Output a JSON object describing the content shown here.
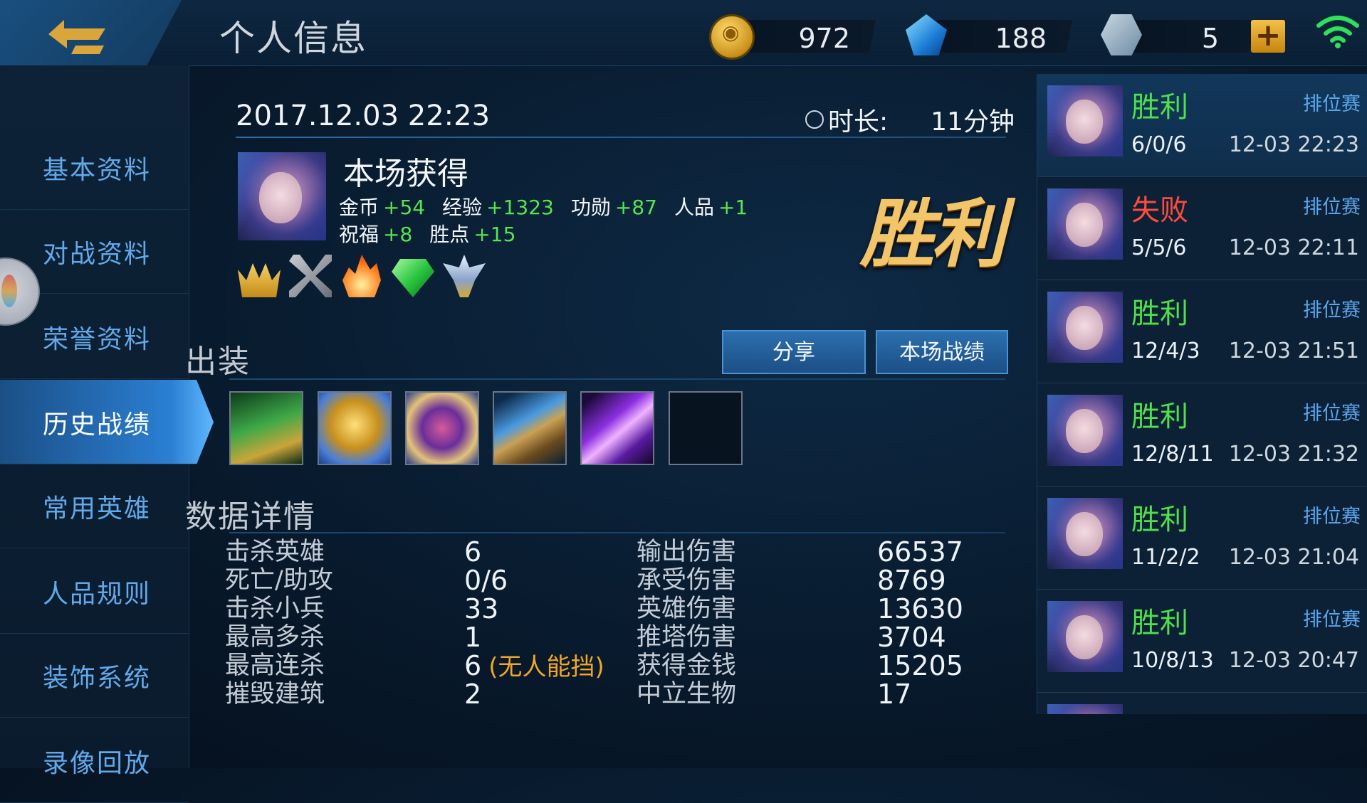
{
  "header": {
    "title": "个人信息",
    "gold": "972",
    "diamonds": "188",
    "vouchers": "5"
  },
  "sidebar": {
    "items": [
      {
        "label": "基本资料",
        "name": "sidebar-item-basic-info"
      },
      {
        "label": "对战资料",
        "name": "sidebar-item-battle-info"
      },
      {
        "label": "荣誉资料",
        "name": "sidebar-item-honor-info"
      },
      {
        "label": "历史战绩",
        "name": "sidebar-item-match-history"
      },
      {
        "label": "常用英雄",
        "name": "sidebar-item-common-heroes"
      },
      {
        "label": "人品规则",
        "name": "sidebar-item-credit-rules"
      },
      {
        "label": "装饰系统",
        "name": "sidebar-item-decoration"
      },
      {
        "label": "录像回放",
        "name": "sidebar-item-replay"
      }
    ],
    "active_index": 3
  },
  "match": {
    "datetime": "2017.12.03 22:23",
    "duration_label": "时长:",
    "duration_value": "11分钟",
    "earn_title": "本场获得",
    "rewards_row1": [
      {
        "label": "金币",
        "value": "+54"
      },
      {
        "label": "经验",
        "value": "+1323"
      },
      {
        "label": "功勋",
        "value": "+87"
      },
      {
        "label": "人品",
        "value": "+1"
      }
    ],
    "rewards_row2": [
      {
        "label": "祝福",
        "value": "+8"
      },
      {
        "label": "胜点",
        "value": "+15"
      }
    ],
    "result": "胜利",
    "badges": [
      "crown-icon",
      "crossed-swords-icon",
      "fire-icon",
      "emerald-icon",
      "winged-emblem-icon"
    ]
  },
  "equipment": {
    "title": "出装",
    "share_label": "分享",
    "scoreboard_label": "本场战绩",
    "items": [
      "boots-item-icon",
      "golden-mask-item-icon",
      "rune-axe-item-icon",
      "staff-item-icon",
      "purple-blade-item-icon",
      "empty-slot"
    ]
  },
  "stats": {
    "title": "数据详情",
    "left": [
      {
        "label": "击杀英雄",
        "value": "6"
      },
      {
        "label": "死亡/助攻",
        "value": "0/6"
      },
      {
        "label": "击杀小兵",
        "value": "33"
      },
      {
        "label": "最高多杀",
        "value": "1"
      },
      {
        "label": "最高连杀",
        "value": "6",
        "note": "(无人能挡)"
      },
      {
        "label": "摧毁建筑",
        "value": "2"
      }
    ],
    "right": [
      {
        "label": "输出伤害",
        "value": "66537"
      },
      {
        "label": "承受伤害",
        "value": "8769"
      },
      {
        "label": "英雄伤害",
        "value": "13630"
      },
      {
        "label": "推塔伤害",
        "value": "3704"
      },
      {
        "label": "获得金钱",
        "value": "15205"
      },
      {
        "label": "中立生物",
        "value": "17"
      }
    ]
  },
  "history": [
    {
      "result": "胜利",
      "win": true,
      "mode": "排位赛",
      "kda": "6/0/6",
      "date": "12-03 22:23"
    },
    {
      "result": "失败",
      "win": false,
      "mode": "排位赛",
      "kda": "5/5/6",
      "date": "12-03 22:11"
    },
    {
      "result": "胜利",
      "win": true,
      "mode": "排位赛",
      "kda": "12/4/3",
      "date": "12-03 21:51"
    },
    {
      "result": "胜利",
      "win": true,
      "mode": "排位赛",
      "kda": "12/8/11",
      "date": "12-03 21:32"
    },
    {
      "result": "胜利",
      "win": true,
      "mode": "排位赛",
      "kda": "11/2/2",
      "date": "12-03 21:04"
    },
    {
      "result": "胜利",
      "win": true,
      "mode": "排位赛",
      "kda": "10/8/13",
      "date": "12-03 20:47"
    }
  ],
  "colors": {
    "win": "#4fe04a",
    "lose": "#ff4a3c",
    "reward_value": "#56e64e",
    "mode": "#5aa7ee",
    "accent_blue": "#2b7fd3"
  }
}
